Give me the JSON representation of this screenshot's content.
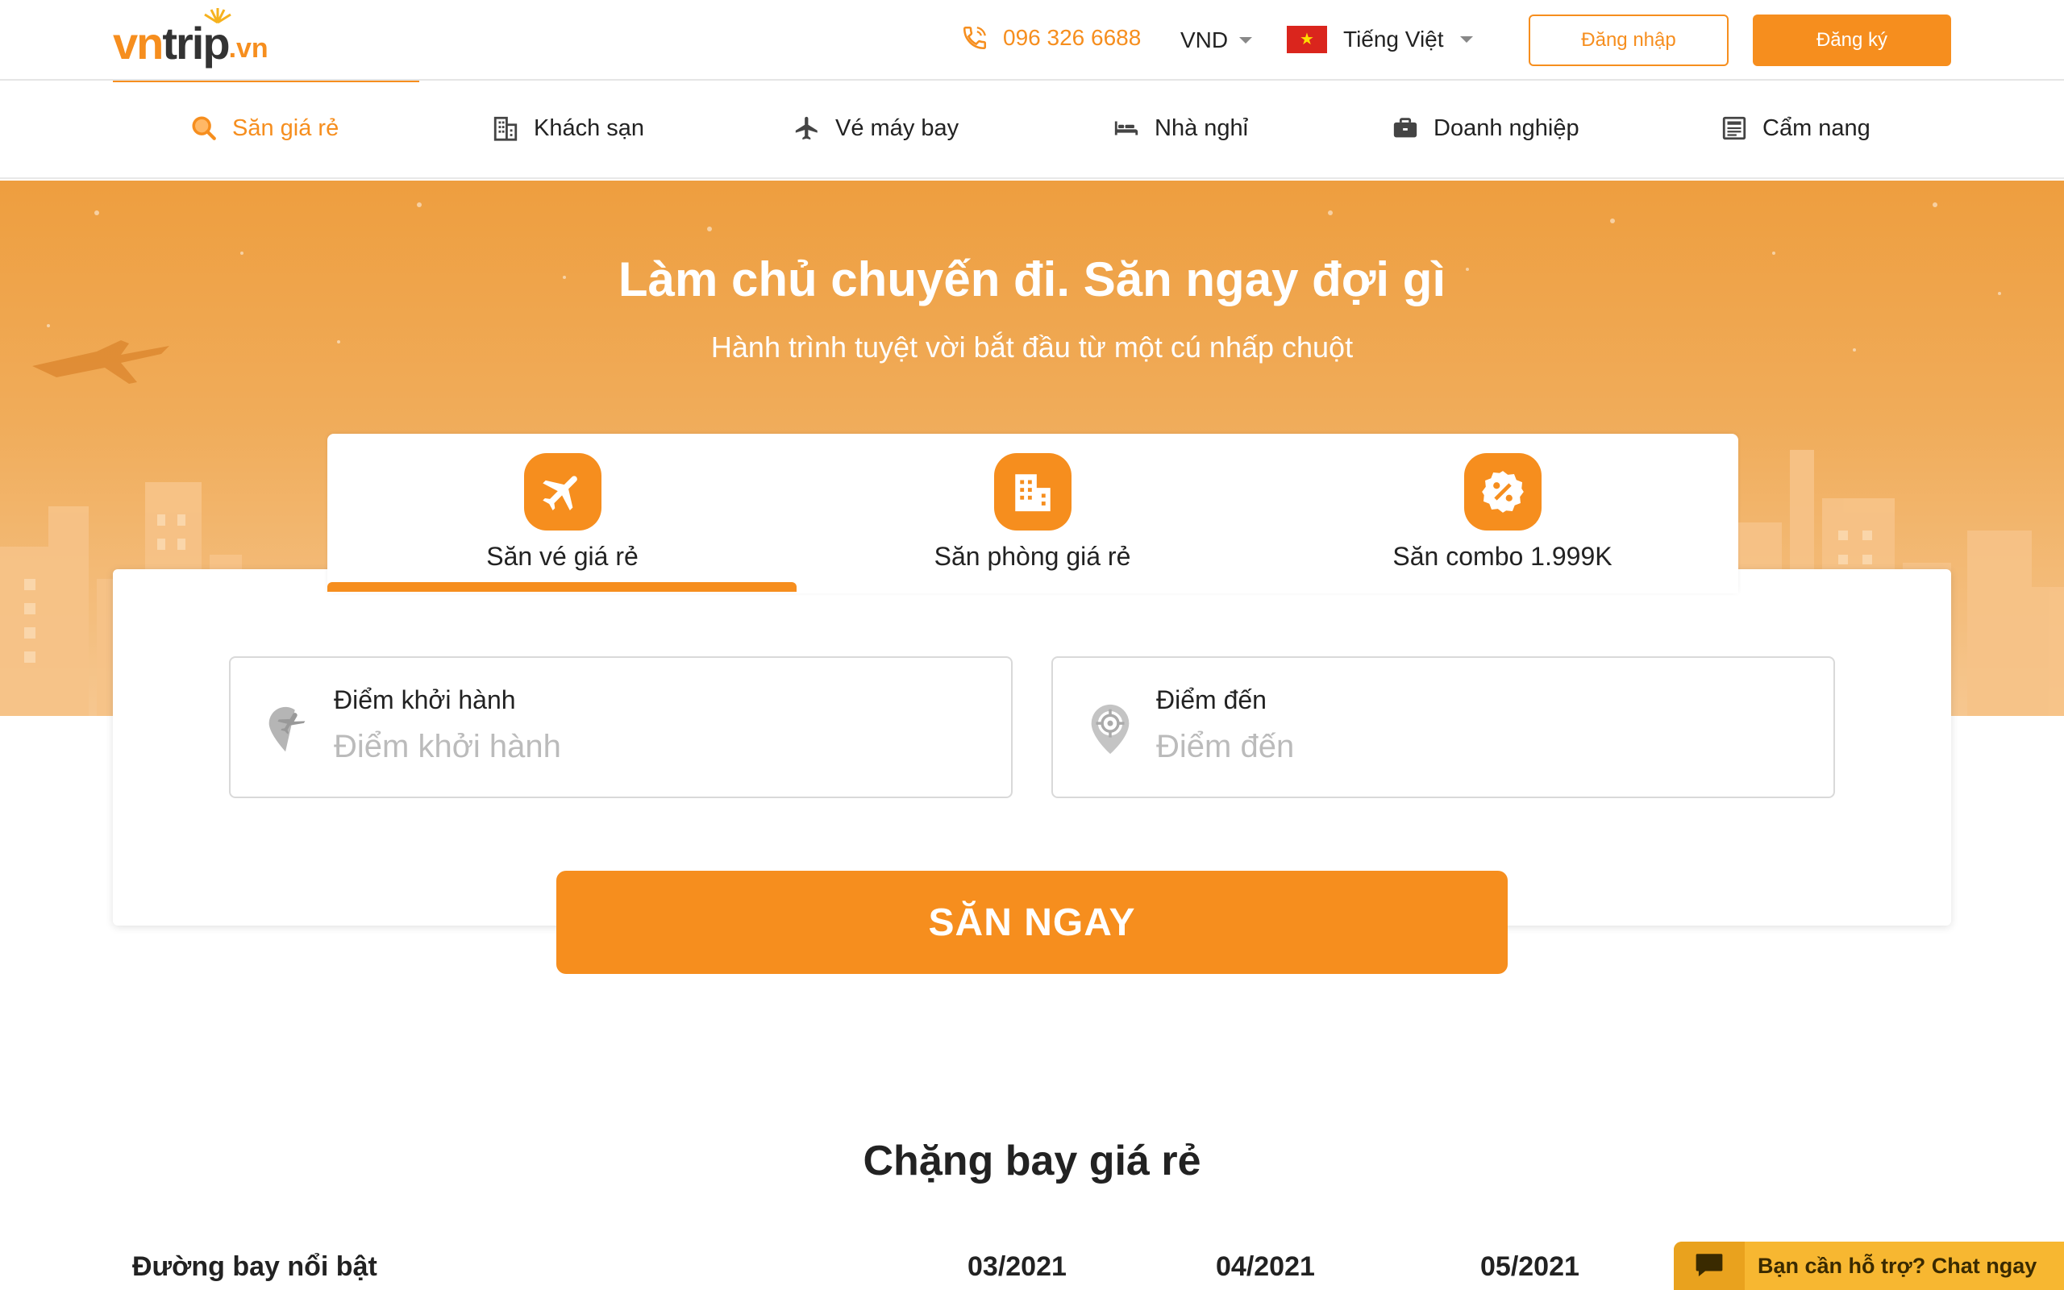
{
  "header": {
    "logo": {
      "vn": "vn",
      "trip": "trip",
      "domain": ".vn"
    },
    "phone": "096 326 6688",
    "currency": "VND",
    "language": "Tiếng Việt",
    "login_label": "Đăng nhập",
    "register_label": "Đăng ký"
  },
  "nav": {
    "items": [
      {
        "label": "Săn giá rẻ",
        "icon": "search-icon",
        "active": true
      },
      {
        "label": "Khách sạn",
        "icon": "building-icon",
        "active": false
      },
      {
        "label": "Vé máy bay",
        "icon": "plane-icon",
        "active": false
      },
      {
        "label": "Nhà nghỉ",
        "icon": "bed-icon",
        "active": false
      },
      {
        "label": "Doanh nghiệp",
        "icon": "briefcase-icon",
        "active": false
      },
      {
        "label": "Cẩm nang",
        "icon": "news-icon",
        "active": false
      }
    ]
  },
  "hero": {
    "title": "Làm chủ chuyến đi. Săn ngay đợi gì",
    "subtitle": "Hành trình tuyệt vời bắt đầu từ một cú nhấp chuột"
  },
  "search": {
    "tabs": [
      {
        "label": "Săn vé giá rẻ",
        "icon": "plane-icon",
        "active": true
      },
      {
        "label": "Săn phòng giá rẻ",
        "icon": "building-icon",
        "active": false
      },
      {
        "label": "Săn combo 1.999K",
        "icon": "percent-badge-icon",
        "active": false
      }
    ],
    "origin": {
      "label": "Điểm khởi hành",
      "placeholder": "Điểm khởi hành",
      "value": ""
    },
    "destination": {
      "label": "Điểm đến",
      "placeholder": "Điểm đến",
      "value": ""
    },
    "submit_label": "SĂN NGAY"
  },
  "cheap_flights": {
    "title": "Chặng bay giá rẻ",
    "columns": [
      "Đường bay nổi bật",
      "03/2021",
      "04/2021",
      "05/2021"
    ]
  },
  "chat": {
    "label": "Bạn cần hỗ trợ? Chat ngay"
  },
  "colors": {
    "accent": "#f68e1e",
    "chat": "#f7b731"
  }
}
